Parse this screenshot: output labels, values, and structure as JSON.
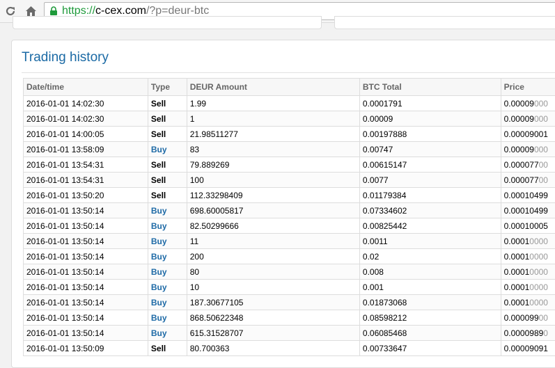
{
  "browser": {
    "url_scheme": "https://",
    "url_host": "c-cex.com",
    "url_path": "/?p=deur-btc"
  },
  "panel": {
    "title": "Trading history"
  },
  "table": {
    "headers": [
      "Date/time",
      "Type",
      "DEUR Amount",
      "BTC Total",
      "Price"
    ],
    "rows": [
      {
        "date": "2016-01-01 14:02:30",
        "type": "Sell",
        "amount": "1.99",
        "total": "0.0001791",
        "price_main": "0.00009",
        "price_dim": "000"
      },
      {
        "date": "2016-01-01 14:02:30",
        "type": "Sell",
        "amount": "1",
        "total": "0.00009",
        "price_main": "0.00009",
        "price_dim": "000"
      },
      {
        "date": "2016-01-01 14:00:05",
        "type": "Sell",
        "amount": "21.98511277",
        "total": "0.00197888",
        "price_main": "0.00009001",
        "price_dim": ""
      },
      {
        "date": "2016-01-01 13:58:09",
        "type": "Buy",
        "amount": "83",
        "total": "0.00747",
        "price_main": "0.00009",
        "price_dim": "000"
      },
      {
        "date": "2016-01-01 13:54:31",
        "type": "Sell",
        "amount": "79.889269",
        "total": "0.00615147",
        "price_main": "0.000077",
        "price_dim": "00"
      },
      {
        "date": "2016-01-01 13:54:31",
        "type": "Sell",
        "amount": "100",
        "total": "0.0077",
        "price_main": "0.000077",
        "price_dim": "00"
      },
      {
        "date": "2016-01-01 13:50:20",
        "type": "Sell",
        "amount": "112.33298409",
        "total": "0.01179384",
        "price_main": "0.00010499",
        "price_dim": ""
      },
      {
        "date": "2016-01-01 13:50:14",
        "type": "Buy",
        "amount": "698.60005817",
        "total": "0.07334602",
        "price_main": "0.00010499",
        "price_dim": ""
      },
      {
        "date": "2016-01-01 13:50:14",
        "type": "Buy",
        "amount": "82.50299666",
        "total": "0.00825442",
        "price_main": "0.00010005",
        "price_dim": ""
      },
      {
        "date": "2016-01-01 13:50:14",
        "type": "Buy",
        "amount": "11",
        "total": "0.0011",
        "price_main": "0.0001",
        "price_dim": "0000"
      },
      {
        "date": "2016-01-01 13:50:14",
        "type": "Buy",
        "amount": "200",
        "total": "0.02",
        "price_main": "0.0001",
        "price_dim": "0000"
      },
      {
        "date": "2016-01-01 13:50:14",
        "type": "Buy",
        "amount": "80",
        "total": "0.008",
        "price_main": "0.0001",
        "price_dim": "0000"
      },
      {
        "date": "2016-01-01 13:50:14",
        "type": "Buy",
        "amount": "10",
        "total": "0.001",
        "price_main": "0.0001",
        "price_dim": "0000"
      },
      {
        "date": "2016-01-01 13:50:14",
        "type": "Buy",
        "amount": "187.30677105",
        "total": "0.01873068",
        "price_main": "0.0001",
        "price_dim": "0000"
      },
      {
        "date": "2016-01-01 13:50:14",
        "type": "Buy",
        "amount": "868.50622348",
        "total": "0.08598212",
        "price_main": "0.000099",
        "price_dim": "00"
      },
      {
        "date": "2016-01-01 13:50:14",
        "type": "Buy",
        "amount": "615.31528707",
        "total": "0.06085468",
        "price_main": "0.0000989",
        "price_dim": "0"
      },
      {
        "date": "2016-01-01 13:50:09",
        "type": "Sell",
        "amount": "80.700363",
        "total": "0.00733647",
        "price_main": "0.00009091",
        "price_dim": ""
      }
    ]
  },
  "icons": {
    "reload": "reload-icon",
    "home": "home-icon",
    "lock": "lock-icon"
  },
  "colors": {
    "url_scheme": "#1f9a3b",
    "title": "#1b6aa5",
    "buy": "#1e6aa6",
    "sell": "#000000",
    "price_dim": "#999999"
  }
}
